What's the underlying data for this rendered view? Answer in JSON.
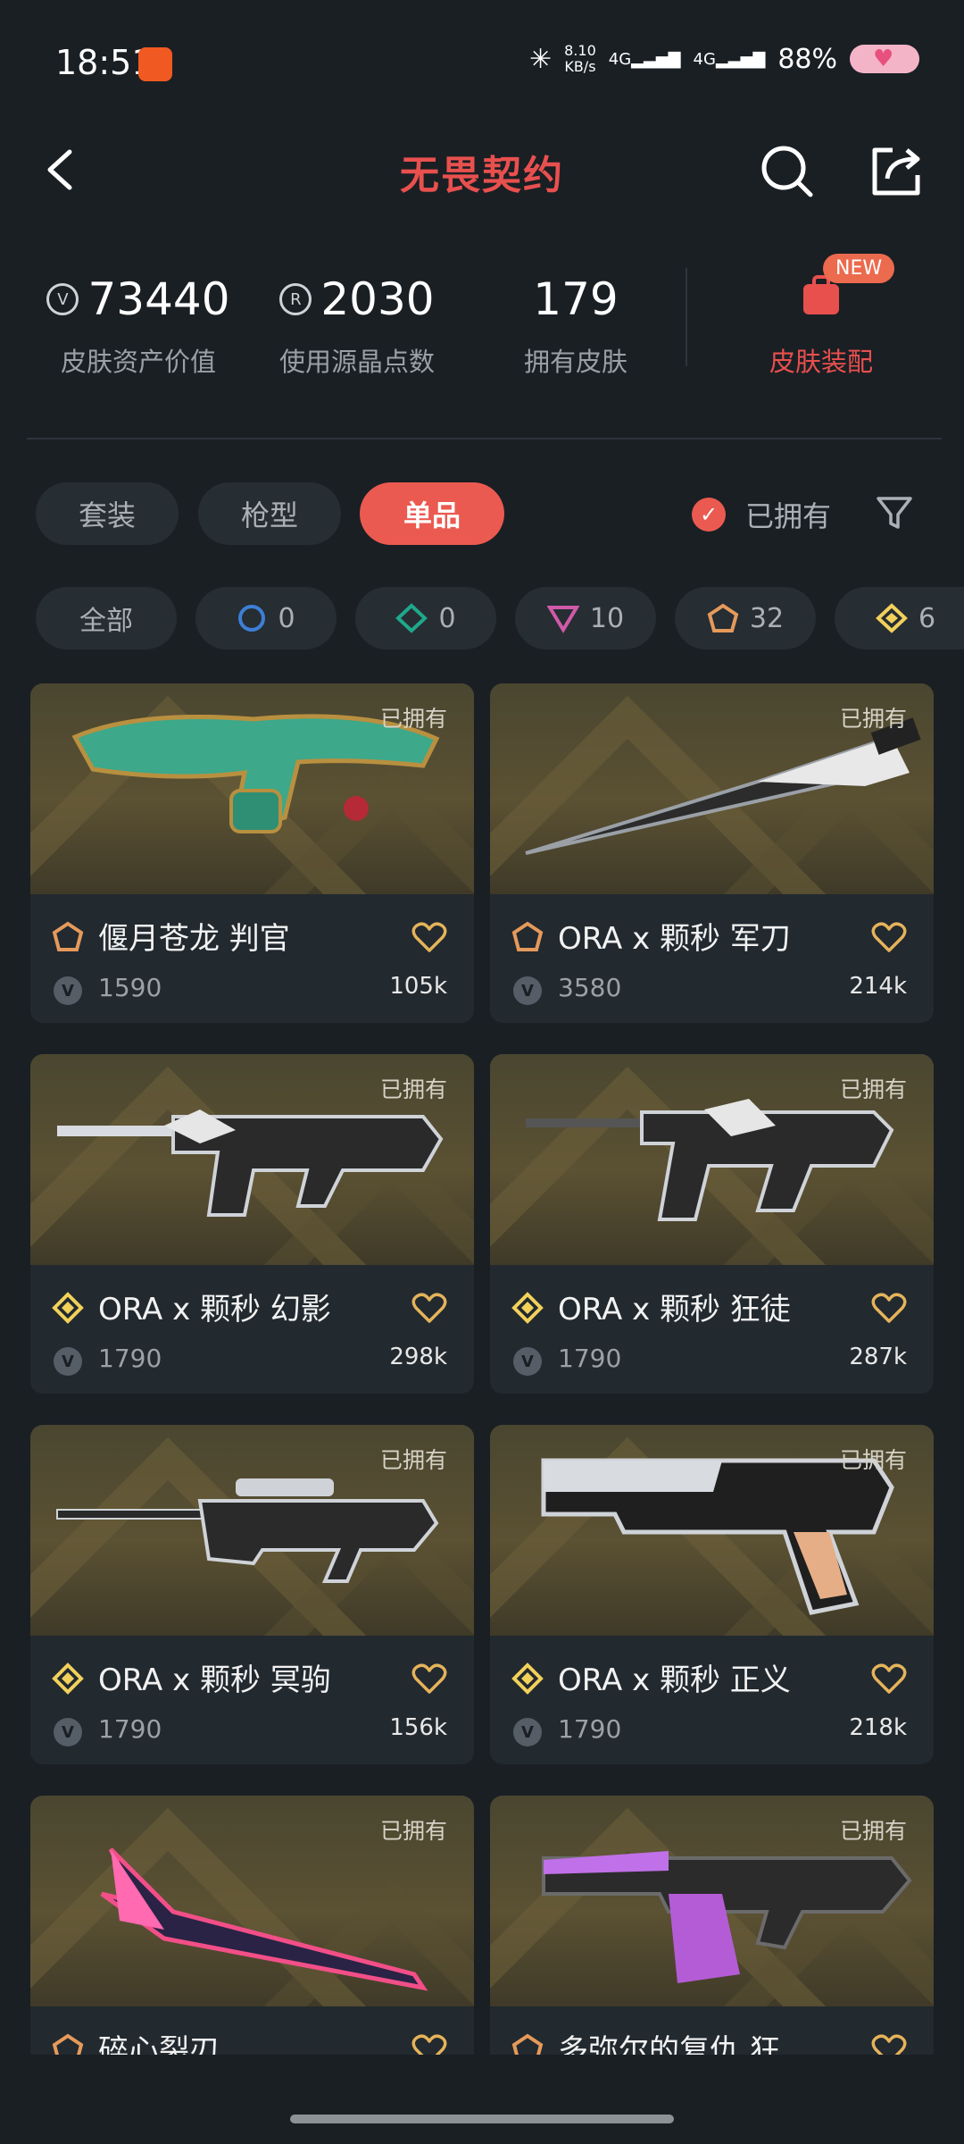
{
  "status_bar": {
    "time": "18:51",
    "net_speed": "8.10\nKB/s",
    "net1": "4G",
    "net2": "4G",
    "battery": "88%"
  },
  "nav": {
    "title": "无畏契约"
  },
  "stats": [
    {
      "value": "73440",
      "label": "皮肤资产价值",
      "icon": "vp-coin-icon"
    },
    {
      "value": "2030",
      "label": "使用源晶点数",
      "icon": "radianite-icon"
    },
    {
      "value": "179",
      "label": "拥有皮肤"
    }
  ],
  "dress": {
    "label": "皮肤装配",
    "badge": "NEW"
  },
  "tabs": [
    "套装",
    "枪型",
    "单品"
  ],
  "active_tab": "单品",
  "owned_filter": "已拥有",
  "chips": [
    {
      "label": "全部"
    },
    {
      "count": "0",
      "tier": "select",
      "color": "#3d7fd6"
    },
    {
      "count": "0",
      "tier": "deluxe",
      "color": "#1fa88b"
    },
    {
      "count": "10",
      "tier": "premium",
      "color": "#d05aa8"
    },
    {
      "count": "32",
      "tier": "exclusive",
      "color": "#e59a5b"
    },
    {
      "count": "6",
      "tier": "ultra",
      "color": "#f2d15b"
    }
  ],
  "cards": [
    {
      "tag": "已拥有",
      "name": "偃月苍龙 判官",
      "tier": "exclusive",
      "price": "1590",
      "likes": "105k"
    },
    {
      "tag": "已拥有",
      "name": "ORA x 颗秒 军刀",
      "tier": "exclusive",
      "price": "3580",
      "likes": "214k"
    },
    {
      "tag": "已拥有",
      "name": "ORA x 颗秒 幻影",
      "tier": "ultra",
      "price": "1790",
      "likes": "298k"
    },
    {
      "tag": "已拥有",
      "name": "ORA x 颗秒 狂徒",
      "tier": "ultra",
      "price": "1790",
      "likes": "287k"
    },
    {
      "tag": "已拥有",
      "name": "ORA x 颗秒 冥驹",
      "tier": "ultra",
      "price": "1790",
      "likes": "156k"
    },
    {
      "tag": "已拥有",
      "name": "ORA x 颗秒 正义",
      "tier": "ultra",
      "price": "1790",
      "likes": "218k"
    },
    {
      "tag": "已拥有",
      "name": "碎心裂刃",
      "tier": "exclusive",
      "price": "",
      "likes": ""
    },
    {
      "tag": "已拥有",
      "name": "多弥尔的复仇 狂…",
      "tier": "exclusive",
      "price": "",
      "likes": ""
    }
  ],
  "colors": {
    "accent": "#eb5a50",
    "background": "#1a1f24",
    "card": "#22292f"
  }
}
